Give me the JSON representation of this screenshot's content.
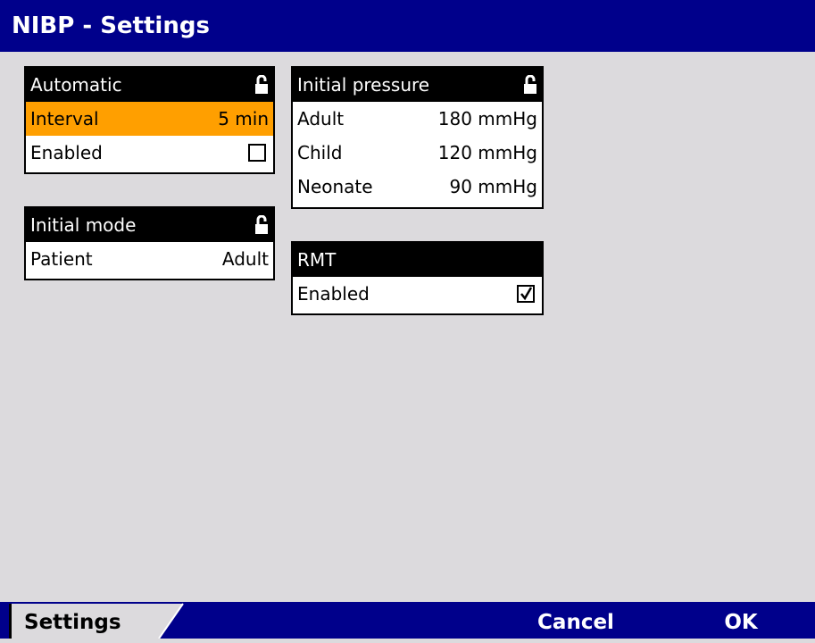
{
  "title": "NIBP - Settings",
  "panels": {
    "automatic": {
      "header": "Automatic",
      "interval_label": "Interval",
      "interval_value": "5 min",
      "enabled_label": "Enabled",
      "enabled_checked": false
    },
    "initial_mode": {
      "header": "Initial mode",
      "patient_label": "Patient",
      "patient_value": "Adult"
    },
    "initial_pressure": {
      "header": "Initial pressure",
      "rows": [
        {
          "label": "Adult",
          "value": "180 mmHg"
        },
        {
          "label": "Child",
          "value": "120 mmHg"
        },
        {
          "label": "Neonate",
          "value": "90 mmHg"
        }
      ]
    },
    "rmt": {
      "header": "RMT",
      "enabled_label": "Enabled",
      "enabled_checked": true
    }
  },
  "softkeys": {
    "settings": "Settings",
    "cancel": "Cancel",
    "ok": "OK"
  },
  "colors": {
    "title_bar": "#00008b",
    "background": "#dcdadd",
    "selection": "#ff9f00"
  },
  "icons": {
    "lock": "lock-icon",
    "checkbox_empty": "checkbox-unchecked-icon",
    "checkbox_checked": "checkbox-checked-icon"
  }
}
